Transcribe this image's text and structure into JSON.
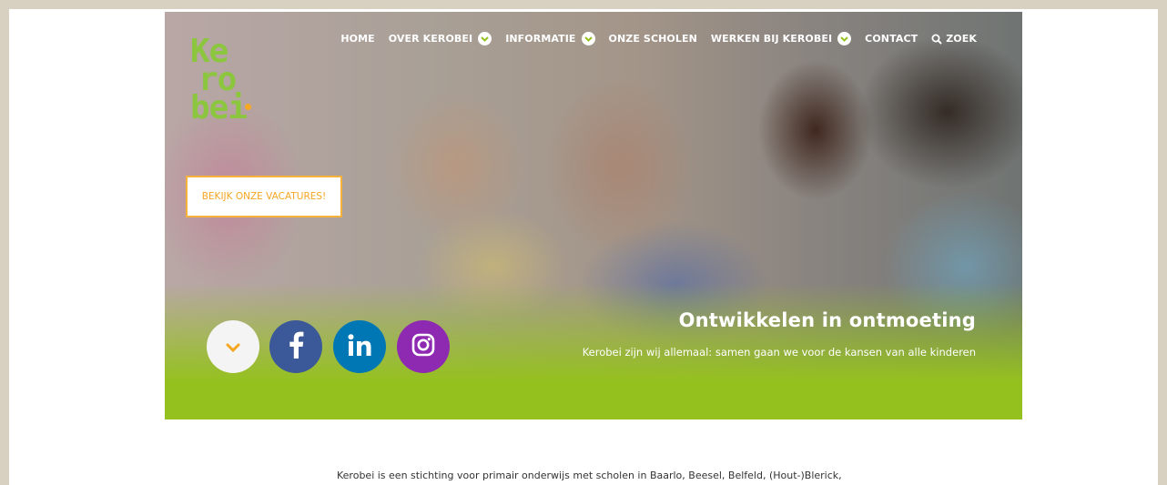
{
  "brand": {
    "logo_lines": [
      "Ke",
      "ro",
      "bei"
    ],
    "colors": {
      "green": "#95c11f",
      "logo_green": "#8cc63f",
      "orange": "#f5a623",
      "facebook": "#3b5998",
      "linkedin": "#0077b5",
      "instagram": "#8e2ab1"
    }
  },
  "nav": {
    "items": [
      {
        "label": "HOME",
        "dropdown": false
      },
      {
        "label": "OVER KEROBEI",
        "dropdown": true
      },
      {
        "label": "INFORMATIE",
        "dropdown": true
      },
      {
        "label": "ONZE SCHOLEN",
        "dropdown": false
      },
      {
        "label": "WERKEN BIJ KEROBEI",
        "dropdown": true
      },
      {
        "label": "CONTACT",
        "dropdown": false
      }
    ],
    "search_label": "ZOEK"
  },
  "hero": {
    "cta_label": "BEKIJK ONZE VACATURES!",
    "title": "Ontwikkelen in ontmoeting",
    "subtitle": "Kerobei zijn wij allemaal: samen gaan we voor de kansen van alle kinderen",
    "social": [
      {
        "icon": "chevron-down-icon"
      },
      {
        "icon": "facebook-icon"
      },
      {
        "icon": "linkedin-icon"
      },
      {
        "icon": "instagram-icon"
      }
    ]
  },
  "content": {
    "intro": "Kerobei is een stichting voor primair onderwijs met scholen in Baarlo, Beesel, Belfeld, (Hout-)Blerick,"
  }
}
